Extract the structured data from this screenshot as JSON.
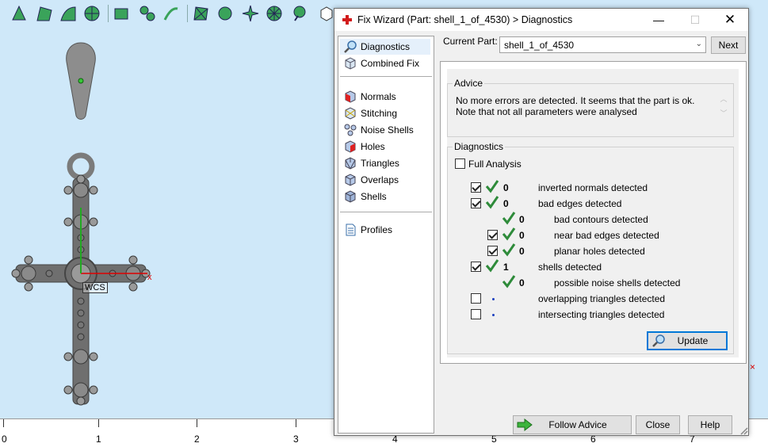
{
  "window": {
    "title": "Fix Wizard (Part: shell_1_of_4530) > Diagnostics"
  },
  "nav": {
    "items": [
      {
        "label": "Diagnostics",
        "icon": "magnifier-icon",
        "selected": true
      },
      {
        "label": "Combined Fix",
        "icon": "cube-icon"
      },
      {
        "label": "Normals",
        "icon": "normals-cube-icon"
      },
      {
        "label": "Stitching",
        "icon": "stitching-cube-icon"
      },
      {
        "label": "Noise Shells",
        "icon": "noise-shells-icon"
      },
      {
        "label": "Holes",
        "icon": "holes-cube-icon"
      },
      {
        "label": "Triangles",
        "icon": "triangles-cube-icon"
      },
      {
        "label": "Overlaps",
        "icon": "overlaps-cube-icon"
      },
      {
        "label": "Shells",
        "icon": "shells-cube-icon"
      },
      {
        "label": "Profiles",
        "icon": "document-icon"
      }
    ]
  },
  "current_part": {
    "label": "Current Part:",
    "value": "shell_1_of_4530",
    "next_label": "Next"
  },
  "advice": {
    "title": "Advice",
    "text": "No more errors are detected. It seems that the part is ok. Note that not all parameters were analysed"
  },
  "diagnostics": {
    "title": "Diagnostics",
    "full_analysis_label": "Full Analysis",
    "rows": [
      {
        "checkbox": true,
        "checked": true,
        "status": "ok",
        "count": "0",
        "label": "inverted normals detected",
        "indent": 0
      },
      {
        "checkbox": true,
        "checked": true,
        "status": "ok",
        "count": "0",
        "label": "bad edges detected",
        "indent": 0
      },
      {
        "checkbox": false,
        "checked": false,
        "status": "ok",
        "count": "0",
        "label": "bad contours detected",
        "indent": 1
      },
      {
        "checkbox": true,
        "checked": true,
        "status": "ok",
        "count": "0",
        "label": "near bad edges detected",
        "indent": 1
      },
      {
        "checkbox": true,
        "checked": true,
        "status": "ok",
        "count": "0",
        "label": "planar holes detected",
        "indent": 1
      },
      {
        "checkbox": true,
        "checked": true,
        "status": "ok",
        "count": "1",
        "label": "shells detected",
        "indent": 0
      },
      {
        "checkbox": false,
        "checked": false,
        "status": "ok",
        "count": "0",
        "label": "possible noise shells detected",
        "indent": 1
      },
      {
        "checkbox": true,
        "checked": false,
        "status": "pending",
        "count": "",
        "label": "overlapping triangles detected",
        "indent": 0
      },
      {
        "checkbox": true,
        "checked": false,
        "status": "pending",
        "count": "",
        "label": "intersecting triangles detected",
        "indent": 0
      }
    ],
    "update_label": "Update"
  },
  "footer": {
    "follow_advice_label": "Follow Advice",
    "close_label": "Close",
    "help_label": "Help"
  },
  "viewport": {
    "wcs_label": "WCS",
    "x_axis_label": "x",
    "ruler_labels": [
      "0",
      "1",
      "2",
      "3",
      "4",
      "5",
      "6",
      "7"
    ]
  },
  "colors": {
    "viewport_bg": "#cfe8f9",
    "ok_check": "#2e8b3a",
    "accent": "#0078d7",
    "model_green": "#2f8f2f"
  }
}
